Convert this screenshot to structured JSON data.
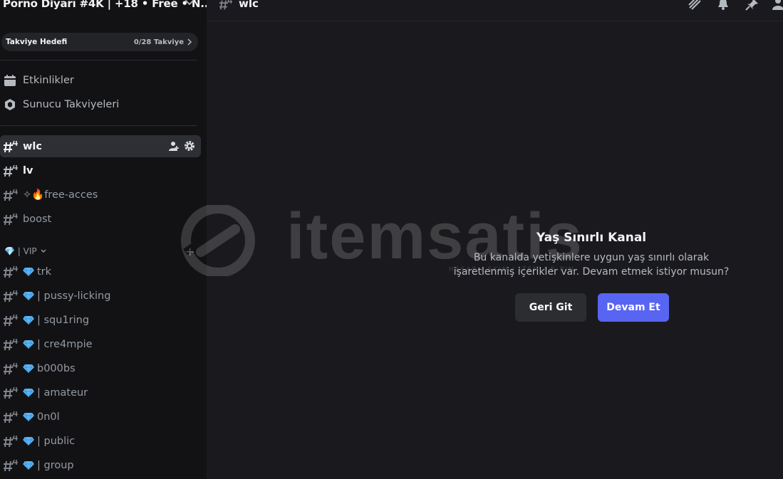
{
  "server": {
    "name": "Porno Diyarı #4K | +18  • Free • N..."
  },
  "boost": {
    "label": "Takviye Hedefi",
    "count": "0/28 Takviye"
  },
  "nav": [
    {
      "label": "Etkinlikler",
      "icon": "calendar-icon"
    },
    {
      "label": "Sunucu Takviyeleri",
      "icon": "boost-gem-icon"
    }
  ],
  "channels_top": [
    {
      "label": "wlc",
      "state": "active"
    },
    {
      "label": "lv",
      "state": "unread"
    },
    {
      "label": "✧🔥free-acces",
      "state": "normal"
    },
    {
      "label": "boost",
      "state": "normal"
    }
  ],
  "category": {
    "label": "💎 | VIP"
  },
  "channels_vip": [
    {
      "label": "trk"
    },
    {
      "label": " | pussy-licking"
    },
    {
      "label": " | squ1ring"
    },
    {
      "label": " | cre4mpie"
    },
    {
      "label": "b000bs"
    },
    {
      "label": " | amateur"
    },
    {
      "label": "0n0l"
    },
    {
      "label": " | public"
    },
    {
      "label": " | group"
    }
  ],
  "header": {
    "channel": "wlc"
  },
  "watermark": {
    "brand": "itemsatis",
    "sub": "HESAP / SKIN / ITEM / E-PIN"
  },
  "gate": {
    "title": "Yaş Sınırlı Kanal",
    "description": "Bu kanalda yetişkinlere uygun yaş sınırlı olarak işaretlenmiş içerikler var. Devam etmek istiyor musun?",
    "back_label": "Geri Git",
    "continue_label": "Devam Et"
  },
  "colors": {
    "accent": "#5865f2",
    "sidebar_bg": "#121214",
    "main_bg": "#1a1a1e",
    "gem": "#5fb7f5"
  }
}
